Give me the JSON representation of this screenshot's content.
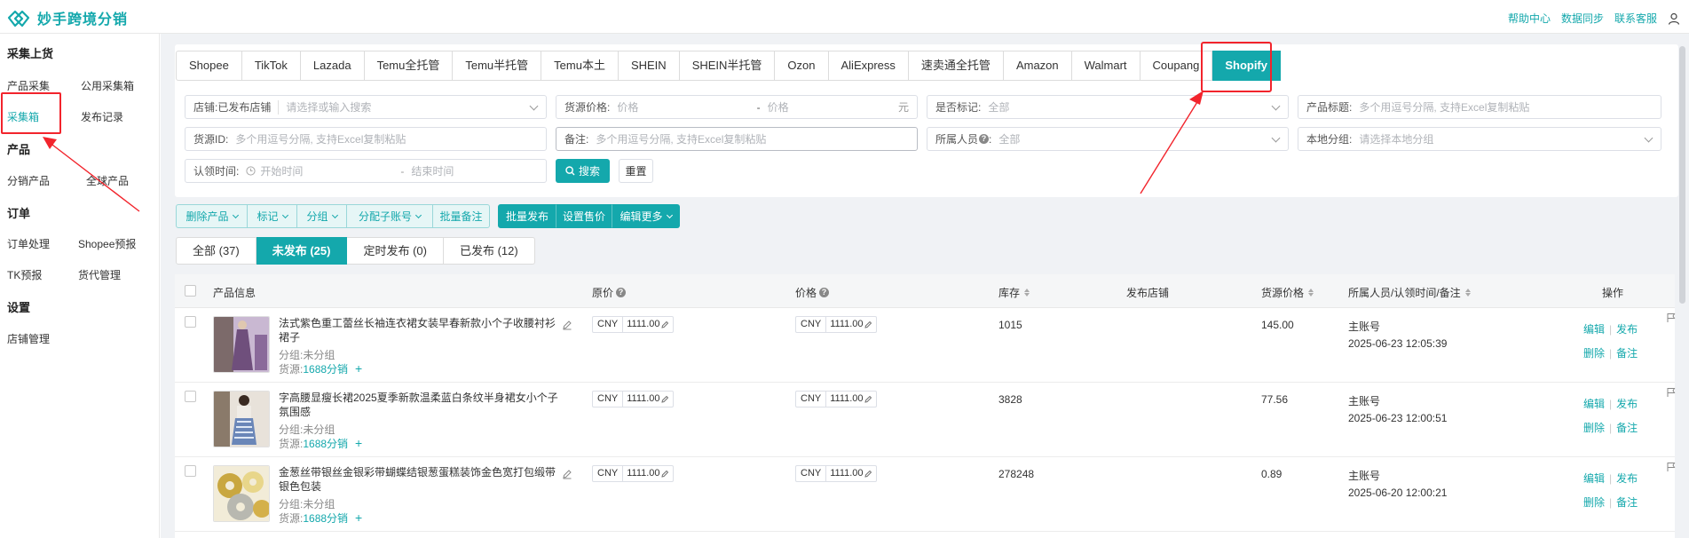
{
  "app": {
    "title": "妙手跨境分销",
    "top_links": [
      "帮助中心",
      "数据同步",
      "联系客服"
    ]
  },
  "sidebar": {
    "sections": [
      {
        "title": "采集上货",
        "items": [
          "产品采集",
          "公用采集箱",
          "采集箱",
          "发布记录"
        ]
      },
      {
        "title": "产品",
        "items": [
          "分销产品",
          "全球产品"
        ]
      },
      {
        "title": "订单",
        "items": [
          "订单处理",
          "Shopee预报",
          "TK预报",
          "货代管理"
        ]
      },
      {
        "title": "设置",
        "items": [
          "店铺管理"
        ]
      }
    ],
    "active": "采集箱"
  },
  "platform_tabs": [
    "Shopee",
    "TikTok",
    "Lazada",
    "Temu全托管",
    "Temu半托管",
    "Temu本土",
    "SHEIN",
    "SHEIN半托管",
    "Ozon",
    "AliExpress",
    "速卖通全托管",
    "Amazon",
    "Walmart",
    "Coupang",
    "Shopify"
  ],
  "active_platform": "Shopify",
  "filters": {
    "store_label": "店铺:",
    "store_value": "已发布店铺",
    "store_placeholder": "请选择或输入搜索",
    "source_price_label": "货源价格:",
    "price_min_placeholder": "价格",
    "price_dash": "-",
    "price_max_placeholder": "价格",
    "price_unit": "元",
    "marked_label": "是否标记:",
    "marked_value": "全部",
    "product_title_label": "产品标题:",
    "product_title_placeholder": "多个用逗号分隔, 支持Excel复制粘贴",
    "source_id_label": "货源ID:",
    "source_id_placeholder": "多个用逗号分隔, 支持Excel复制粘贴",
    "remark_label": "备注:",
    "remark_placeholder": "多个用逗号分隔, 支持Excel复制粘贴",
    "owner_label": "所属人员",
    "owner_value": "全部",
    "local_group_label": "本地分组:",
    "local_group_placeholder": "请选择本地分组",
    "claim_time_label": "认领时间:",
    "start_placeholder": "开始时间",
    "time_dash": "-",
    "end_placeholder": "结束时间",
    "search_button": "搜索",
    "reset_button": "重置"
  },
  "actions": {
    "light": [
      "删除产品",
      "标记",
      "分组",
      "分配子账号",
      "批量备注"
    ],
    "dark": [
      "批量发布",
      "设置售价",
      "编辑更多"
    ]
  },
  "status_tabs": [
    {
      "label": "全部 (37)"
    },
    {
      "label": "未发布 (25)"
    },
    {
      "label": "定时发布 (0)"
    },
    {
      "label": "已发布 (12)"
    }
  ],
  "active_status": "未发布 (25)",
  "table": {
    "headers": {
      "product_info": "产品信息",
      "original_price": "原价",
      "price": "价格",
      "stock": "库存",
      "publish_store": "发布店铺",
      "source_price": "货源价格",
      "owner_time_remark": "所属人员/认领时间/备注",
      "operation": "操作"
    },
    "rows": [
      {
        "title": "法式紫色重工蕾丝长袖连衣裙女装早春新款小个子收腰衬衫裙子",
        "group_label": "分组:",
        "group": "未分组",
        "source_label": "货源:",
        "source": "1688分销",
        "currency": "CNY",
        "original_price": "1111.00",
        "price": "1111.00",
        "stock": "1015",
        "source_price": "145.00",
        "owner": "主账号",
        "time": "2025-06-23 12:05:39",
        "thumb_colors": [
          "#6f4f7c",
          "#c9b8d2",
          "#8a6a9a"
        ]
      },
      {
        "title": "字高腰显瘦长裙2025夏季新款温柔蓝白条纹半身裙女小个子氛围感",
        "group_label": "分组:",
        "group": "未分组",
        "source_label": "货源:",
        "source": "1688分销",
        "currency": "CNY",
        "original_price": "1111.00",
        "price": "1111.00",
        "stock": "3828",
        "source_price": "77.56",
        "owner": "主账号",
        "time": "2025-06-23 12:00:51",
        "thumb_colors": [
          "#8a7a6a",
          "#6a86b8",
          "#d9d3cb"
        ]
      },
      {
        "title": "金葱丝带银丝金银彩带蝴蝶结银葱蛋糕装饰金色宽打包缎带银色包装",
        "group_label": "分组:",
        "group": "未分组",
        "source_label": "货源:",
        "source": "1688分销",
        "currency": "CNY",
        "original_price": "1111.00",
        "price": "1111.00",
        "stock": "278248",
        "source_price": "0.89",
        "owner": "主账号",
        "time": "2025-06-20 12:00:21",
        "thumb_colors": [
          "#c9a740",
          "#e8d68a",
          "#b8b8b0"
        ]
      }
    ],
    "ops": {
      "edit": "编辑",
      "publish": "发布",
      "delete": "删除",
      "remark": "备注"
    }
  },
  "colors": {
    "accent": "#14a8ac",
    "annotation": "#f2242c"
  }
}
